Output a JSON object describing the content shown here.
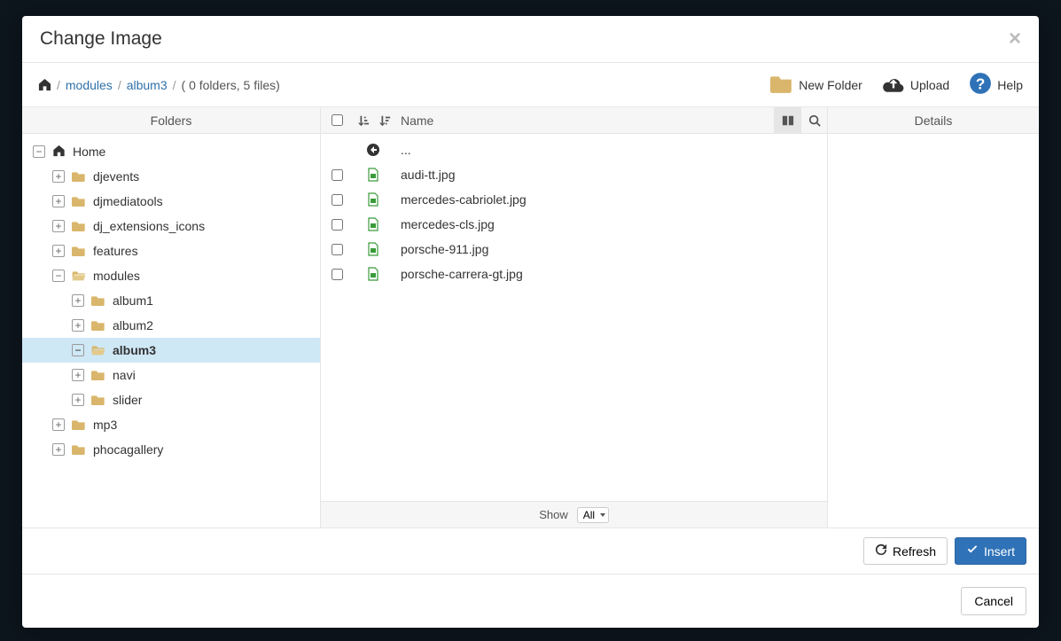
{
  "title": "Change Image",
  "breadcrumb": {
    "modules": "modules",
    "album": "album3",
    "stat": "( 0 folders, 5 files)"
  },
  "toolbar": {
    "new_folder": "New Folder",
    "upload": "Upload",
    "help": "Help"
  },
  "columns": {
    "folders": "Folders",
    "name": "Name",
    "details": "Details"
  },
  "tree": {
    "home": "Home",
    "items": [
      {
        "label": "djevents",
        "depth": 1
      },
      {
        "label": "djmediatools",
        "depth": 1
      },
      {
        "label": "dj_extensions_icons",
        "depth": 1
      },
      {
        "label": "features",
        "depth": 1
      },
      {
        "label": "modules",
        "depth": 1,
        "expanded": true
      },
      {
        "label": "album1",
        "depth": 2
      },
      {
        "label": "album2",
        "depth": 2
      },
      {
        "label": "album3",
        "depth": 2,
        "selected": true,
        "expanded": true
      },
      {
        "label": "navi",
        "depth": 2
      },
      {
        "label": "slider",
        "depth": 2
      },
      {
        "label": "mp3",
        "depth": 1
      },
      {
        "label": "phocagallery",
        "depth": 1
      }
    ]
  },
  "files": {
    "parent": "...",
    "items": [
      {
        "name": "audi-tt.jpg"
      },
      {
        "name": "mercedes-cabriolet.jpg"
      },
      {
        "name": "mercedes-cls.jpg"
      },
      {
        "name": "porsche-911.jpg"
      },
      {
        "name": "porsche-carrera-gt.jpg"
      }
    ]
  },
  "pagination": {
    "show": "Show",
    "selected": "All"
  },
  "actions": {
    "refresh": "Refresh",
    "insert": "Insert",
    "cancel": "Cancel"
  }
}
